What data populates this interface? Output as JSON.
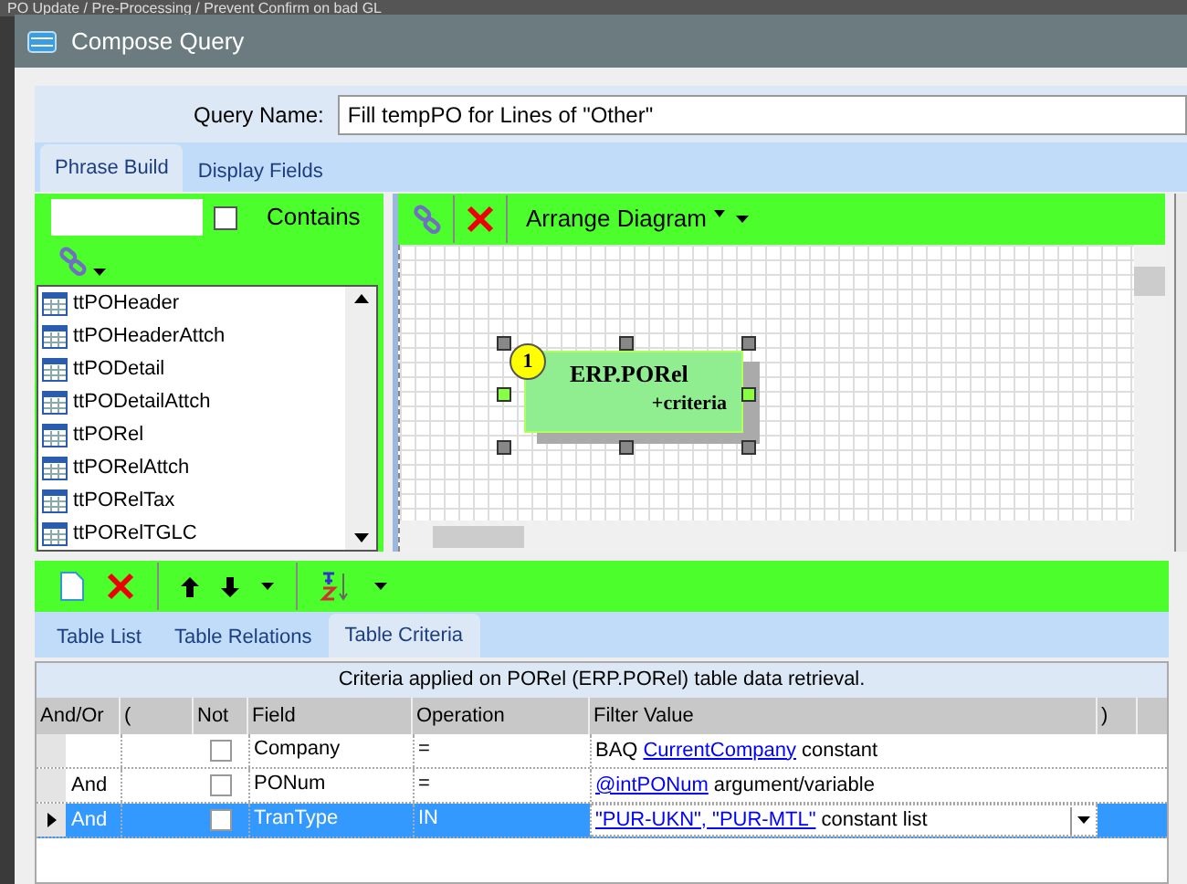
{
  "background_window": {
    "title": "PO Update / Pre-Processing / Prevent Confirm on bad GL"
  },
  "window": {
    "title": "Compose Query"
  },
  "query_name": {
    "label": "Query Name:",
    "value": "Fill tempPO for Lines of \"Other\""
  },
  "tabs": [
    {
      "label": "Phrase Build",
      "selected": true
    },
    {
      "label": "Display Fields",
      "selected": false
    }
  ],
  "table_search": {
    "contains_label": "Contains",
    "checked": false
  },
  "tables": [
    {
      "name": "ttPOHeader"
    },
    {
      "name": "ttPOHeaderAttch"
    },
    {
      "name": "ttPODetail"
    },
    {
      "name": "ttPODetailAttch"
    },
    {
      "name": "ttPORel"
    },
    {
      "name": "ttPORelAttch"
    },
    {
      "name": "ttPORelTax"
    },
    {
      "name": "ttPORelTGLC"
    }
  ],
  "diagram_toolbar": {
    "arrange_label": "Arrange Diagram"
  },
  "diagram_node": {
    "number": "1",
    "title": "ERP.PORel",
    "subtitle": "+criteria",
    "selected": true
  },
  "bottom_tabs": [
    {
      "label": "Table List",
      "selected": false
    },
    {
      "label": "Table Relations",
      "selected": false
    },
    {
      "label": "Table Criteria",
      "selected": true
    }
  ],
  "criteria": {
    "caption": "Criteria applied on PORel (ERP.PORel)  table data retrieval.",
    "columns": [
      "And/Or",
      "(",
      "Not",
      "Field",
      "Operation",
      "Filter Value",
      ")"
    ],
    "rows": [
      {
        "and_or": "",
        "not": false,
        "field": "Company",
        "operation": "=",
        "value_prefix": "BAQ",
        "value_link": "CurrentCompany",
        "value_suffix": "constant",
        "selected": false
      },
      {
        "and_or": "And",
        "not": false,
        "field": "PONum",
        "operation": "=",
        "value_prefix": "",
        "value_link": "@intPONum",
        "value_suffix": "argument/variable",
        "selected": false
      },
      {
        "and_or": "And",
        "not": false,
        "field": "TranType",
        "operation": "IN",
        "value_prefix": "",
        "value_link": "\"PUR-UKN\", \"PUR-MTL\"",
        "value_suffix": "constant list",
        "selected": true
      }
    ]
  }
}
